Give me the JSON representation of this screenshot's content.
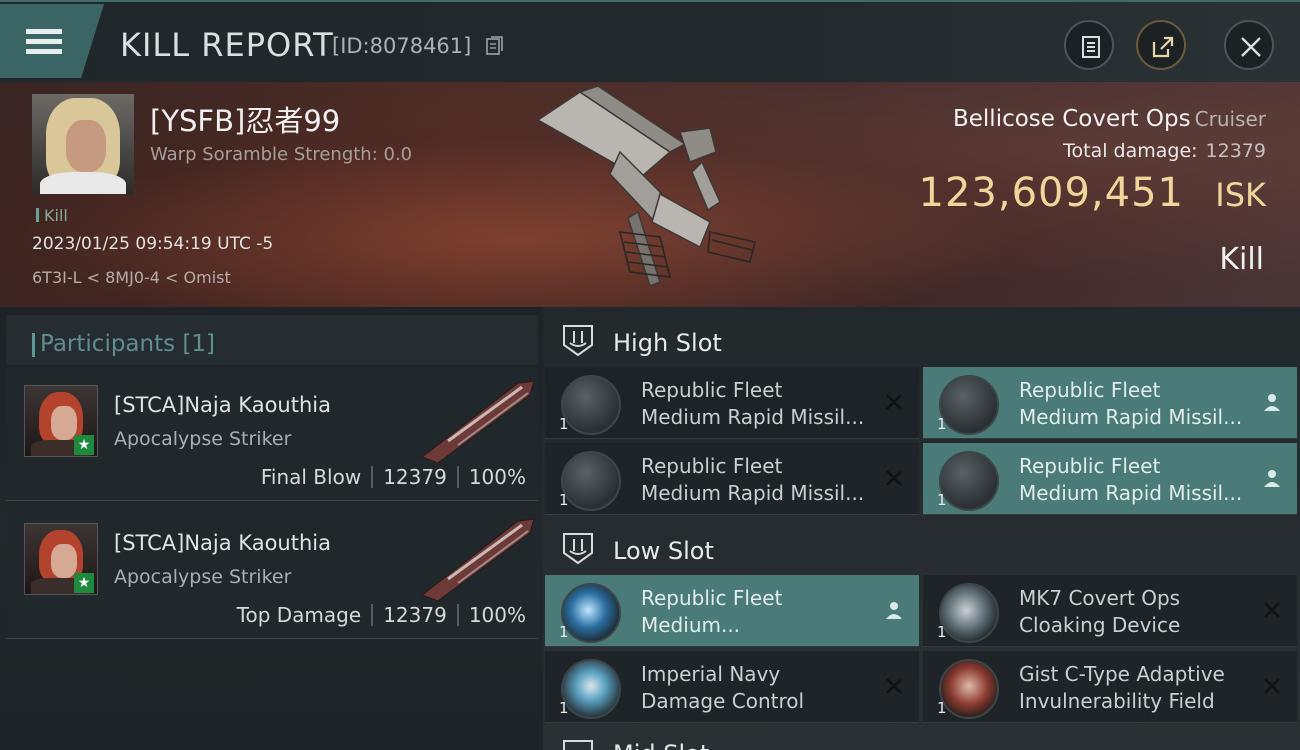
{
  "header": {
    "title": "KILL REPORT",
    "kill_id": "[ID:8078461]"
  },
  "victim": {
    "name": "[YSFB]忍者99",
    "warp_scramble": "Warp Soramble Strength: 0.0",
    "kill_tag": "Kill",
    "datetime": "2023/01/25 09:54:19 UTC -5",
    "location": "6T3I-L < 8MJ0-4 < Omist",
    "ship_name": "Bellicose Covert Ops",
    "ship_class": "Cruiser",
    "total_damage_label": "Total damage:",
    "total_damage": "12379",
    "isk_value": "123,609,451",
    "isk_unit": "ISK",
    "result": "Kill"
  },
  "participants": {
    "title": "Participants",
    "count": "[1]",
    "rows": [
      {
        "name": "[STCA]Naja Kaouthia",
        "ship": "Apocalypse Striker",
        "role": "Final Blow",
        "damage": "12379",
        "percent": "100%"
      },
      {
        "name": "[STCA]Naja Kaouthia",
        "ship": "Apocalypse Striker",
        "role": "Top Damage",
        "damage": "12379",
        "percent": "100%"
      }
    ]
  },
  "fittings": {
    "high_slot": {
      "label": "High Slot",
      "modules": [
        {
          "line1": "Republic Fleet",
          "line2": "Medium Rapid Missil...",
          "qty": "1",
          "status": "destroyed"
        },
        {
          "line1": "Republic Fleet",
          "line2": "Medium Rapid Missil...",
          "qty": "1",
          "status": "dropped"
        },
        {
          "line1": "Republic Fleet",
          "line2": "Medium Rapid Missil...",
          "qty": "1",
          "status": "destroyed"
        },
        {
          "line1": "Republic Fleet",
          "line2": "Medium Rapid Missil...",
          "qty": "1",
          "status": "dropped"
        }
      ]
    },
    "low_slot": {
      "label": "Low Slot",
      "modules": [
        {
          "line1": "Republic Fleet",
          "line2": "Medium...",
          "qty": "1",
          "status": "dropped"
        },
        {
          "line1": "MK7 Covert Ops",
          "line2": "Cloaking Device",
          "qty": "1",
          "status": "destroyed"
        },
        {
          "line1": "Imperial Navy",
          "line2": "Damage Control",
          "qty": "1",
          "status": "destroyed"
        },
        {
          "line1": "Gist C-Type Adaptive",
          "line2": "Invulnerability Field",
          "qty": "1",
          "status": "destroyed"
        }
      ]
    },
    "mid_slot_peek": "Mid Slot"
  },
  "colors": {
    "accent_teal": "#4a7b78",
    "isk_gold": "#f2d59a"
  }
}
